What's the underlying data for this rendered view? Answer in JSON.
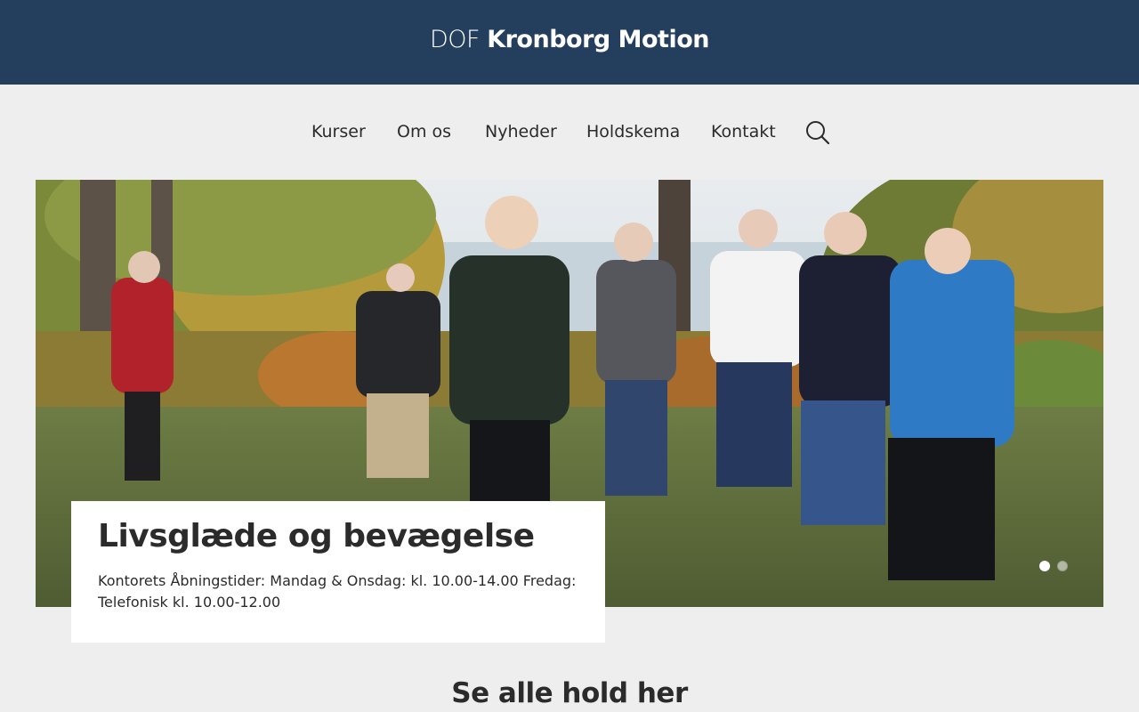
{
  "header": {
    "logo_prefix": "DOF",
    "logo_name": "Kronborg Motion",
    "background_color": "#243f5e"
  },
  "nav": {
    "items": [
      {
        "label": "Kurser"
      },
      {
        "label": "Om os"
      },
      {
        "label": "Nyheder"
      },
      {
        "label": "Holdskema"
      },
      {
        "label": "Kontakt"
      }
    ],
    "search_icon": "search-icon"
  },
  "hero": {
    "image": "photo of a group of women walking on grass with trees and sea in the background",
    "slides_total": 2,
    "active_slide": 1,
    "card": {
      "title": "Livsglæde og bevægelse",
      "text": "Kontorets Åbningstider: Mandag & Onsdag: kl. 10.00-14.00 Fredag: Telefonisk kl. 10.00-12.00"
    }
  },
  "section": {
    "title": "Se alle hold her"
  },
  "colors": {
    "page_background": "#eeeeee",
    "text": "#2b2b2b",
    "card_background": "#ffffff"
  }
}
